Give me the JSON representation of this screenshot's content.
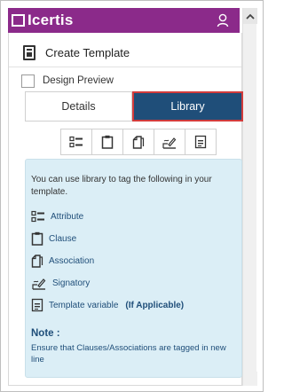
{
  "app": {
    "logo_text": "Icertis"
  },
  "header": {
    "title": "Create Template"
  },
  "design_preview": {
    "label": "Design Preview",
    "checked": false
  },
  "tabs": [
    {
      "label": "Details",
      "active": false
    },
    {
      "label": "Library",
      "active": true
    }
  ],
  "icon_strip": [
    "attribute-icon",
    "clause-icon",
    "association-icon",
    "signatory-icon",
    "template-variable-icon"
  ],
  "library": {
    "intro": "You can use library to tag the following in your template.",
    "items": [
      {
        "icon": "attribute-icon",
        "label": "Attribute"
      },
      {
        "icon": "clause-icon",
        "label": "Clause"
      },
      {
        "icon": "association-icon",
        "label": "Association"
      },
      {
        "icon": "signatory-icon",
        "label": "Signatory"
      },
      {
        "icon": "template-variable-icon",
        "label": "Template variable",
        "extra": "(If Applicable)"
      }
    ],
    "note_title": "Note :",
    "note_text": "Ensure that Clauses/Associations are tagged in new line"
  },
  "colors": {
    "titlebar": "#8b2a8a",
    "active_tab": "#1f4e79",
    "active_tab_border": "#d23c3c",
    "info_background": "#dbeef6",
    "link_text": "#1f4e79"
  }
}
